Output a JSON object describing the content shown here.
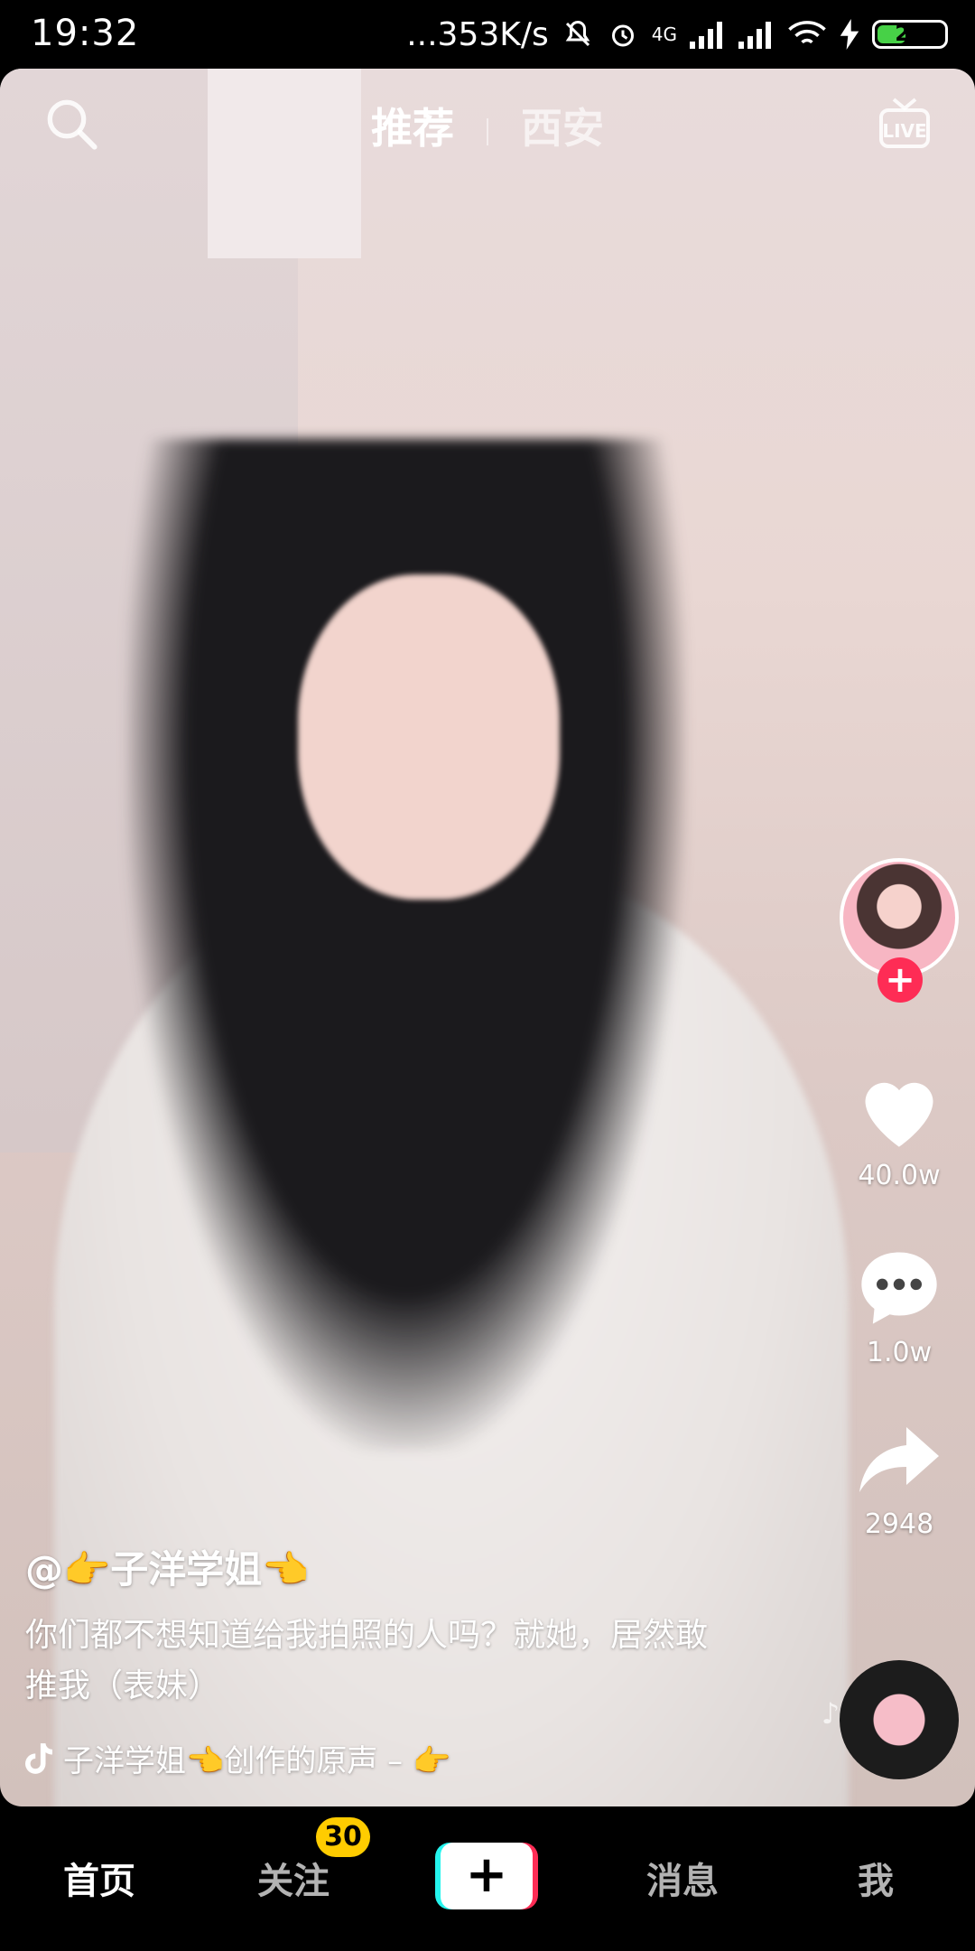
{
  "status_bar": {
    "time": "19:32",
    "network_speed": "...353K/s",
    "network_type": "4G",
    "battery": "24",
    "icons": [
      "mute-bell-icon",
      "alarm-icon",
      "signal-icon",
      "signal-icon",
      "wifi-icon",
      "charging-icon",
      "battery-icon"
    ]
  },
  "top_nav": {
    "tabs": [
      {
        "label": "推荐",
        "active": true
      },
      {
        "label": "西安",
        "active": false
      }
    ],
    "left_icon": "search-icon",
    "right_icon": "live-icon",
    "live_label": "LIVE"
  },
  "rail": {
    "likes": "40.0w",
    "comments": "1.0w",
    "shares": "2948",
    "follow_symbol": "+"
  },
  "caption": {
    "username": "@👉子洋学姐👈",
    "description": "你们都不想知道给我拍照的人吗？就她，居然敢推我（表妹）",
    "music": "子洋学姐👈创作的原声 – 👉"
  },
  "bottom_nav": {
    "items": [
      {
        "label": "首页",
        "active": true
      },
      {
        "label": "关注",
        "badge": "30"
      },
      {
        "label": "+"
      },
      {
        "label": "消息"
      },
      {
        "label": "我"
      }
    ]
  },
  "colors": {
    "accent": "#fe2c55",
    "cyan": "#25f4ee",
    "badge": "#ffcc00"
  }
}
